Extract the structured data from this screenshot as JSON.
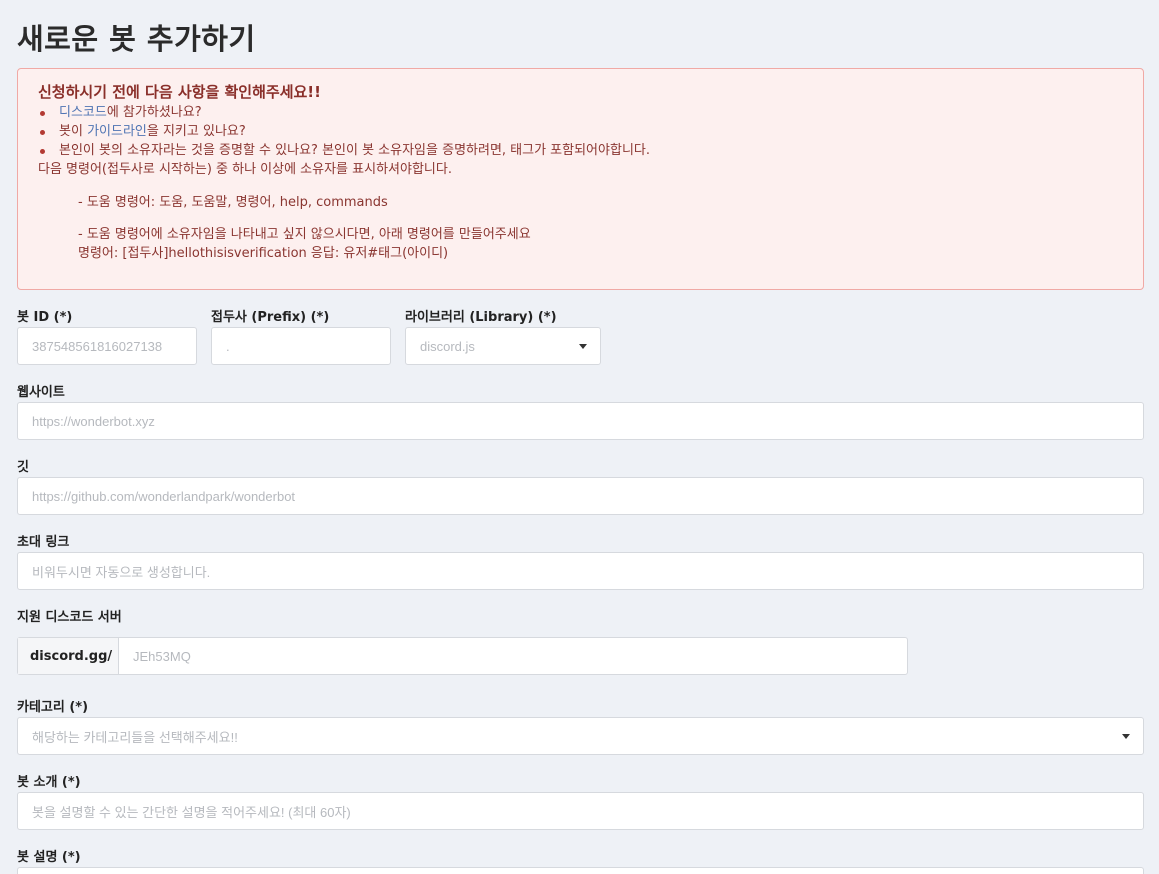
{
  "page": {
    "title": "새로운 봇 추가하기"
  },
  "notice": {
    "title": "신청하시기 전에 다음 사항을 확인해주세요!!",
    "item1_link": "디스코드",
    "item1_text": "에 참가하셨나요?",
    "item2_prefix": "봇이 ",
    "item2_link": "가이드라인",
    "item2_text": "을 지키고 있나요?",
    "item3": "본인이 봇의 소유자라는 것을 증명할 수 있나요? 본인이 봇 소유자임을 증명하려면, 태그가 포함되어야합니다.",
    "line4": "다음 명령어(접두사로 시작하는) 중 하나 이상에 소유자를 표시하셔야합니다.",
    "help_line": "- 도움 명령어: 도움, 도움말, 명령어, help, commands",
    "alt_line": "- 도움 명령어에 소유자임을 나타내고 싶지 않으시다면, 아래 명령어를 만들어주세요",
    "cmd_line": "명령어: [접두사]hellothisisverification 응답: 유저#태그(아이디)"
  },
  "form": {
    "bot_id": {
      "label": "봇 ID (*)",
      "placeholder": "387548561816027138"
    },
    "prefix": {
      "label": "접두사 (Prefix) (*)",
      "placeholder": "."
    },
    "library": {
      "label": "라이브러리 (Library) (*)",
      "value": "discord.js"
    },
    "website": {
      "label": "웹사이트",
      "placeholder": "https://wonderbot.xyz"
    },
    "git": {
      "label": "깃",
      "placeholder": "https://github.com/wonderlandpark/wonderbot"
    },
    "invite": {
      "label": "초대 링크",
      "placeholder": "비워두시면 자동으로 생성합니다."
    },
    "support": {
      "label": "지원 디스코드 서버",
      "addon": "discord.gg/",
      "placeholder": "JEh53MQ"
    },
    "category": {
      "label": "카테고리 (*)",
      "placeholder": "해당하는 카테고리들을 선택해주세요!!"
    },
    "intro": {
      "label": "봇 소개 (*)",
      "placeholder": "봇을 설명할 수 있는 간단한 설명을 적어주세요! (최대 60자)"
    },
    "description": {
      "label": "봇 설명 (*)"
    }
  }
}
